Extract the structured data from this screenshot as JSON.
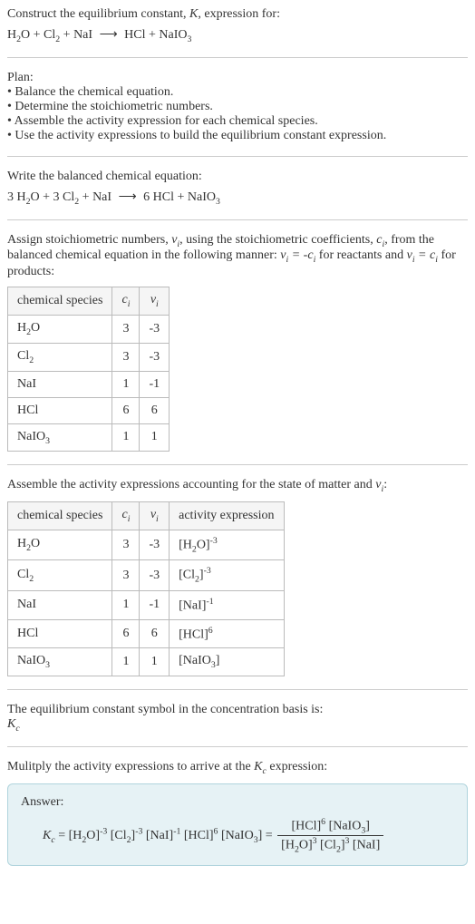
{
  "header": {
    "prompt": "Construct the equilibrium constant, ",
    "K": "K",
    "prompt2": ", expression for:",
    "unbalanced": "H₂O + Cl₂ + NaI ⟶ HCl + NaIO₃"
  },
  "plan": {
    "title": "Plan:",
    "items": [
      "• Balance the chemical equation.",
      "• Determine the stoichiometric numbers.",
      "• Assemble the activity expression for each chemical species.",
      "• Use the activity expressions to build the equilibrium constant expression."
    ]
  },
  "balanced": {
    "title": "Write the balanced chemical equation:",
    "equation": "3 H₂O + 3 Cl₂ + NaI ⟶ 6 HCl + NaIO₃"
  },
  "stoich": {
    "intro1": "Assign stoichiometric numbers, ",
    "nu_i": "νᵢ",
    "intro2": ", using the stoichiometric coefficients, ",
    "c_i": "cᵢ",
    "intro3": ", from the balanced chemical equation in the following manner: ",
    "rel1": "νᵢ = -cᵢ",
    "intro4": " for reactants and ",
    "rel2": "νᵢ = cᵢ",
    "intro5": " for products:",
    "headers": {
      "species": "chemical species",
      "c": "cᵢ",
      "v": "νᵢ"
    },
    "rows": [
      {
        "species": "H₂O",
        "c": "3",
        "v": "-3"
      },
      {
        "species": "Cl₂",
        "c": "3",
        "v": "-3"
      },
      {
        "species": "NaI",
        "c": "1",
        "v": "-1"
      },
      {
        "species": "HCl",
        "c": "6",
        "v": "6"
      },
      {
        "species": "NaIO₃",
        "c": "1",
        "v": "1"
      }
    ]
  },
  "activity": {
    "intro1": "Assemble the activity expressions accounting for the state of matter and ",
    "nu_i": "νᵢ",
    "intro2": ":",
    "headers": {
      "species": "chemical species",
      "c": "cᵢ",
      "v": "νᵢ",
      "act": "activity expression"
    },
    "rows": [
      {
        "species": "H₂O",
        "c": "3",
        "v": "-3",
        "act": "[H₂O]⁻³"
      },
      {
        "species": "Cl₂",
        "c": "3",
        "v": "-3",
        "act": "[Cl₂]⁻³"
      },
      {
        "species": "NaI",
        "c": "1",
        "v": "-1",
        "act": "[NaI]⁻¹"
      },
      {
        "species": "HCl",
        "c": "6",
        "v": "6",
        "act": "[HCl]⁶"
      },
      {
        "species": "NaIO₃",
        "c": "1",
        "v": "1",
        "act": "[NaIO₃]"
      }
    ]
  },
  "symbol": {
    "line1": "The equilibrium constant symbol in the concentration basis is:",
    "Kc": "K_c"
  },
  "multiply": {
    "line1": "Mulitply the activity expressions to arrive at the ",
    "Kc": "K_c",
    "line2": " expression:"
  },
  "answer": {
    "label": "Answer:",
    "lhs": "K_c",
    "eq": " = ",
    "product": "[H₂O]⁻³ [Cl₂]⁻³ [NaI]⁻¹ [HCl]⁶ [NaIO₃]",
    "eq2": " = ",
    "num": "[HCl]⁶ [NaIO₃]",
    "den": "[H₂O]³ [Cl₂]³ [NaI]"
  },
  "chart_data": {
    "type": "table",
    "tables": [
      {
        "title": "stoichiometric numbers",
        "columns": [
          "chemical species",
          "c_i",
          "ν_i"
        ],
        "rows": [
          [
            "H2O",
            3,
            -3
          ],
          [
            "Cl2",
            3,
            -3
          ],
          [
            "NaI",
            1,
            -1
          ],
          [
            "HCl",
            6,
            6
          ],
          [
            "NaIO3",
            1,
            1
          ]
        ]
      },
      {
        "title": "activity expressions",
        "columns": [
          "chemical species",
          "c_i",
          "ν_i",
          "activity expression"
        ],
        "rows": [
          [
            "H2O",
            3,
            -3,
            "[H2O]^-3"
          ],
          [
            "Cl2",
            3,
            -3,
            "[Cl2]^-3"
          ],
          [
            "NaI",
            1,
            -1,
            "[NaI]^-1"
          ],
          [
            "HCl",
            6,
            6,
            "[HCl]^6"
          ],
          [
            "NaIO3",
            1,
            1,
            "[NaIO3]"
          ]
        ]
      }
    ]
  }
}
